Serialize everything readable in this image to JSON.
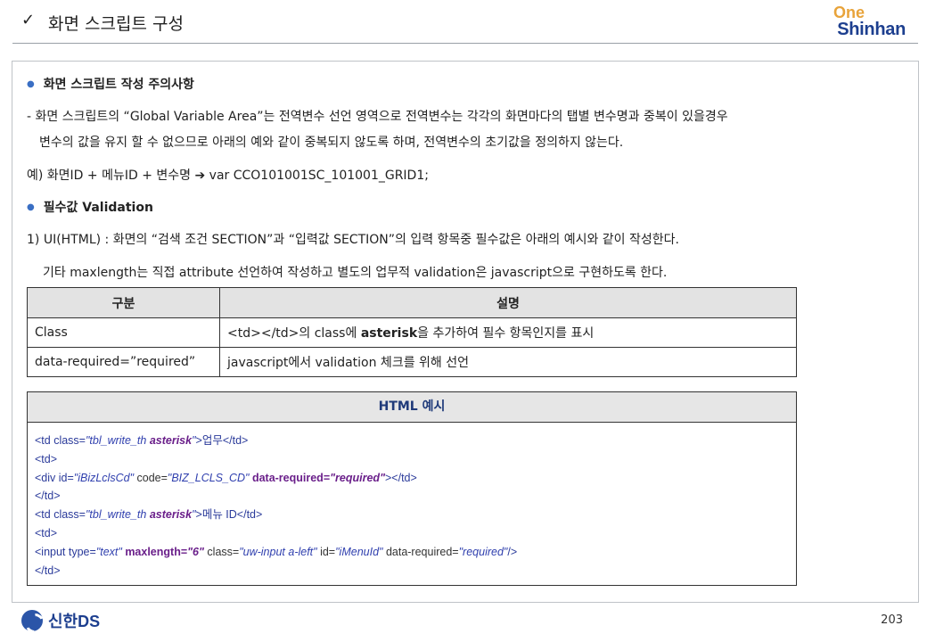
{
  "header": {
    "check_glyph": "✓",
    "title": "화면 스크립트 구성",
    "logo_top": "One",
    "logo_bottom": "Shinhan"
  },
  "section1": {
    "heading": "화면 스크립트 작성 주의사항",
    "line1": "- 화면 스크립트의 “Global Variable Area”는 전역변수 선언 영역으로 전역변수는 각각의 화면마다의 탭별 변수명과 중복이 있을경우",
    "line2": "변수의 값을 유지 할 수 없으므로 아래의  예와 같이 중복되지 않도록 하며, 전역변수의 초기값을 정의하지 않는다.",
    "example": "예) 화면ID + 메뉴ID + 변수명 ➔ var CCO101001SC_101001_GRID1;"
  },
  "section2": {
    "heading": "필수값 Validation",
    "line1": "1) UI(HTML) : 화면의 “검색 조건 SECTION”과  “입력값 SECTION”의  입력 항목중 필수값은 아래의 예시와 같이 작성한다.",
    "line2": "기타 maxlength는 직접 attribute 선언하여 작성하고 별도의 업무적 validation은 javascript으로 구현하도록 한다."
  },
  "table": {
    "headers": [
      "구분",
      "설명"
    ],
    "rows": [
      {
        "col1": "Class",
        "col2_pre": "<td></td>의 class에 ",
        "col2_bold": "asterisk",
        "col2_post": "을 추가하여 필수 항목인지를 표시"
      },
      {
        "col1": "data-required=”required”",
        "col2_pre": "javascript에서 validation 체크를 위해 선언",
        "col2_bold": "",
        "col2_post": ""
      }
    ]
  },
  "html_example": {
    "title": "HTML 예시",
    "l1": {
      "a": "<td class=",
      "b": "\"tbl_write_th ",
      "c": "asterisk",
      "d": "\"",
      "e": ">업무</td>"
    },
    "l2": "<td>",
    "l3": {
      "a": "<div id=",
      "b": "\"iBizLclsCd\"",
      "c": " code=",
      "d": "\"BIZ_LCLS_CD\" ",
      "e": "data-required=",
      "f": "\"required\"",
      "g": "></td>"
    },
    "l4": "</td>",
    "l5": {
      "a": "<td class=",
      "b": "\"tbl_write_th ",
      "c": "asterisk",
      "d": "\"",
      "e": ">메뉴 ID</td>"
    },
    "l6": "<td>",
    "l7": {
      "a": "<input type=",
      "b": "\"text\" ",
      "c": "maxlength=",
      "d": "\"6\"",
      "e": " class=",
      "f": "\"uw-input a-left\"",
      "g": " id=",
      "h": "\"iMenuId\"",
      "i": " data-required=",
      "j": "\"required\"",
      "k": "/>"
    },
    "l8": "</td>"
  },
  "footer": {
    "brand": "신한DS",
    "page_number": "203"
  },
  "colors": {
    "bullet": "#3a6fc4",
    "logo_orange": "#e8a33a",
    "logo_blue": "#1d3f8f",
    "code_blue": "#1f2f8a",
    "code_purple": "#6a1f8a"
  }
}
